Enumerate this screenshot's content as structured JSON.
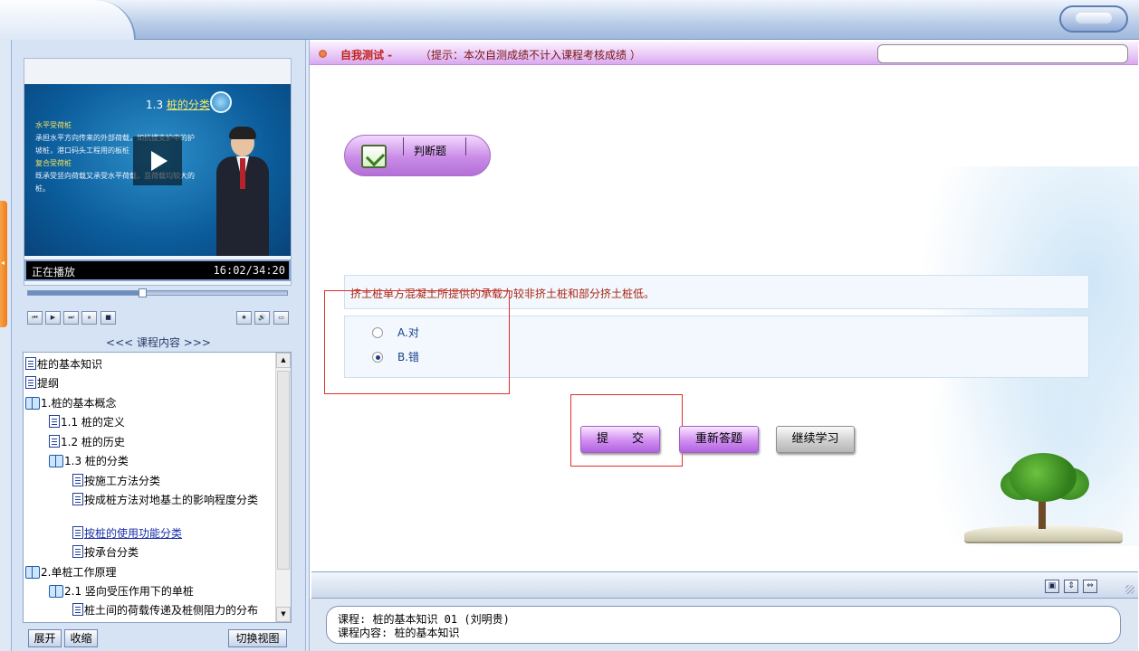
{
  "video": {
    "slide_title_prefix": "1.3 ",
    "slide_title_main": "桩的分类",
    "slide_lines": [
      {
        "text": "水平受荷桩",
        "highlight": true
      },
      {
        "text": "承担水平方向传来的外部荷载，如抗拔支护中的护",
        "highlight": false
      },
      {
        "text": "坡桩，港口码头工程用的板桩",
        "highlight": false
      },
      {
        "text": "复合受荷桩",
        "highlight": true
      },
      {
        "text": "既承受竖向荷载又承受水平荷载，且荷载均较大的",
        "highlight": false
      },
      {
        "text": "桩。",
        "highlight": false
      }
    ],
    "status": "正在播放",
    "time": "16:02/34:20",
    "progress": 0.44
  },
  "player_controls": {
    "first": "⏮",
    "play": "▶",
    "next": "⏭",
    "pause": "⏸",
    "stop": "■",
    "favorite": "★",
    "volume": "🔊",
    "fullscreen": "▭"
  },
  "course_panel": {
    "header": "<<< 课程内容 >>>",
    "items": [
      {
        "label": "桩的基本知识",
        "icon": "doc"
      },
      {
        "label": "提纲",
        "icon": "doc"
      },
      {
        "label": "1.桩的基本概念",
        "icon": "book"
      },
      {
        "label": "1.1 桩的定义",
        "icon": "doc"
      },
      {
        "label": "1.2 桩的历史",
        "icon": "doc"
      },
      {
        "label": "1.3 桩的分类",
        "icon": "book"
      },
      {
        "label": "按施工方法分类",
        "icon": "doc"
      },
      {
        "label": "按成桩方法对地基土的影响程度分类",
        "icon": "doc"
      },
      {
        "label": "按桩的使用功能分类",
        "icon": "doc"
      },
      {
        "label": "按承台分类",
        "icon": "doc"
      },
      {
        "label": "2.单桩工作原理",
        "icon": "book"
      },
      {
        "label": "2.1 竖向受压作用下的单桩",
        "icon": "book"
      },
      {
        "label": "桩土间的荷载传递及桩侧阻力的分布",
        "icon": "doc"
      }
    ],
    "expand_label": "展开",
    "collapse_label": "收缩",
    "switch_view_label": "切换视图"
  },
  "test": {
    "title": "自我测试 -",
    "hint": "（提示：本次自测成绩不计入课程考核成绩 ）",
    "question_type": "判断题",
    "question": "挤土桩单方混凝土所提供的承载力较非挤土桩和部分挤土桩低。",
    "options": [
      {
        "label": "A.对",
        "selected": false
      },
      {
        "label": "B.错",
        "selected": true
      }
    ],
    "submit_label": "提　　交",
    "retry_label": "重新答题",
    "continue_label": "继续学习"
  },
  "status": {
    "course_line": "课程: 桩的基本知识 01 (刘明贵)",
    "content_line": "课程内容: 桩的基本知识"
  }
}
